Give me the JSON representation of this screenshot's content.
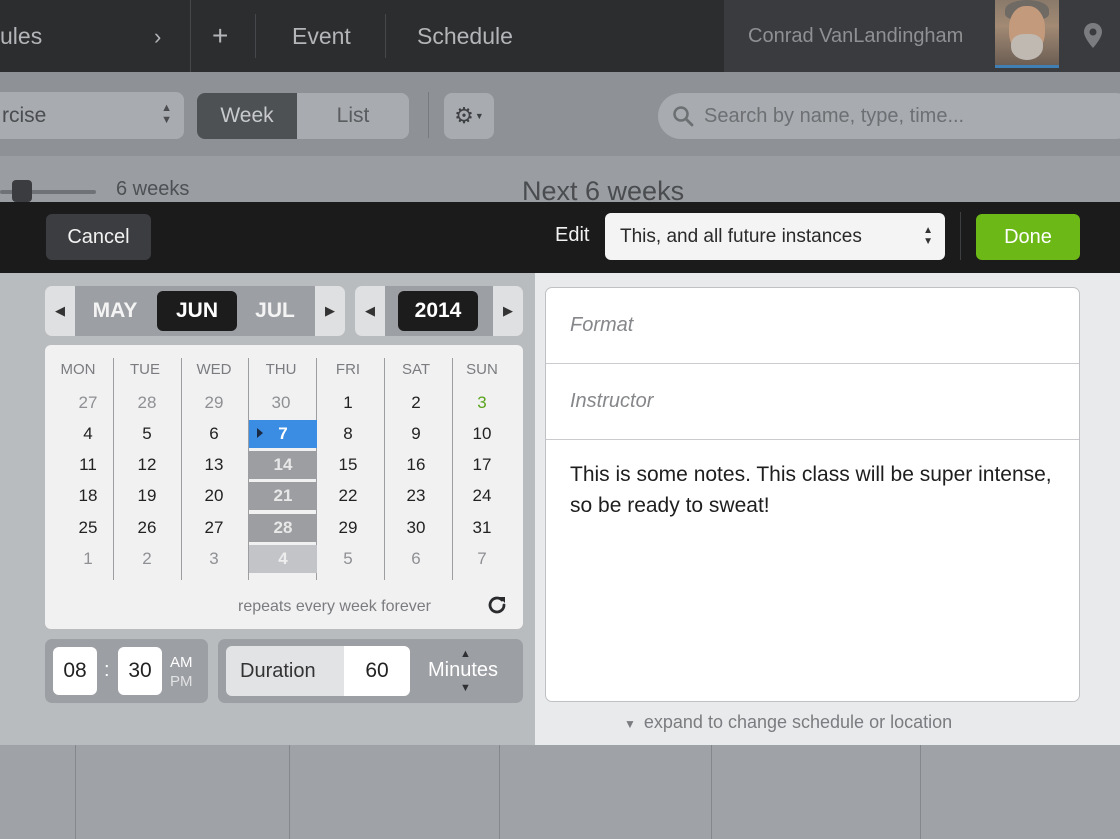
{
  "nav": {
    "schedules_label": "ules",
    "add_label": "+",
    "event_label": "Event",
    "schedule_label": "Schedule",
    "user_name": "Conrad VanLandingham"
  },
  "toolbar": {
    "class_select": "rcise",
    "week_label": "Week",
    "list_label": "List",
    "search_placeholder": "Search by name, type, time..."
  },
  "strip": {
    "weeks_label": "6 weeks",
    "range_label": "Next 6 weeks"
  },
  "modal": {
    "cancel_label": "Cancel",
    "edit_label": "Edit",
    "edit_value": "This, and all future instances",
    "done_label": "Done",
    "done_color": "#6cb817"
  },
  "month_nav": {
    "prev": "MAY",
    "current": "JUN",
    "next": "JUL"
  },
  "year_nav": {
    "current": "2014"
  },
  "calendar": {
    "weekdays": [
      "MON",
      "TUE",
      "WED",
      "THU",
      "FRI",
      "SAT",
      "SUN"
    ],
    "weeks": [
      [
        "27",
        "28",
        "29",
        "30",
        "1",
        "2",
        "3"
      ],
      [
        "4",
        "5",
        "6",
        "7",
        "8",
        "9",
        "10"
      ],
      [
        "11",
        "12",
        "13",
        "14",
        "15",
        "16",
        "17"
      ],
      [
        "18",
        "19",
        "20",
        "21",
        "22",
        "23",
        "24"
      ],
      [
        "25",
        "26",
        "27",
        "28",
        "29",
        "30",
        "31"
      ],
      [
        "1",
        "2",
        "3",
        "4",
        "5",
        "6",
        "7"
      ]
    ],
    "selected_day": "7",
    "repeat_text": "repeats every week forever",
    "today_color": "#3b8de3"
  },
  "time": {
    "hour": "08",
    "minute": "30",
    "am": "AM",
    "pm": "PM",
    "colon": ":"
  },
  "duration": {
    "label": "Duration",
    "value": "60",
    "unit": "Minutes"
  },
  "form": {
    "format_placeholder": "Format",
    "instructor_placeholder": "Instructor",
    "notes": "This is some notes. This class will be super intense, so be ready to sweat!",
    "expand_text": "expand to change schedule or location"
  }
}
